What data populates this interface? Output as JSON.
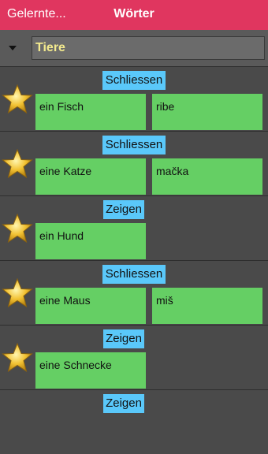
{
  "navbar": {
    "back_label": "Gelernte...",
    "title": "Wörter",
    "color": "#e0365f"
  },
  "category": {
    "label": "Tiere",
    "icon": "caret-down-icon"
  },
  "rows": [
    {
      "toggle": "Schliessen",
      "word": "ein Fisch",
      "translation": "ribe",
      "icon": "star-icon"
    },
    {
      "toggle": "Schliessen",
      "word": "eine Katze",
      "translation": "mačka",
      "icon": "star-icon"
    },
    {
      "toggle": "Zeigen",
      "word": "ein Hund",
      "translation": "",
      "icon": "star-icon"
    },
    {
      "toggle": "Schliessen",
      "word": "eine Maus",
      "translation": "miš",
      "icon": "star-icon"
    },
    {
      "toggle": "Zeigen",
      "word": "eine Schnecke",
      "translation": "",
      "icon": "star-icon"
    },
    {
      "toggle": "Zeigen",
      "word": "",
      "translation": "",
      "icon": ""
    }
  ],
  "colors": {
    "toggle": "#5ac8fa",
    "card": "#65cf64",
    "background": "#4a4a4a",
    "category_text": "#f3ea8e"
  }
}
